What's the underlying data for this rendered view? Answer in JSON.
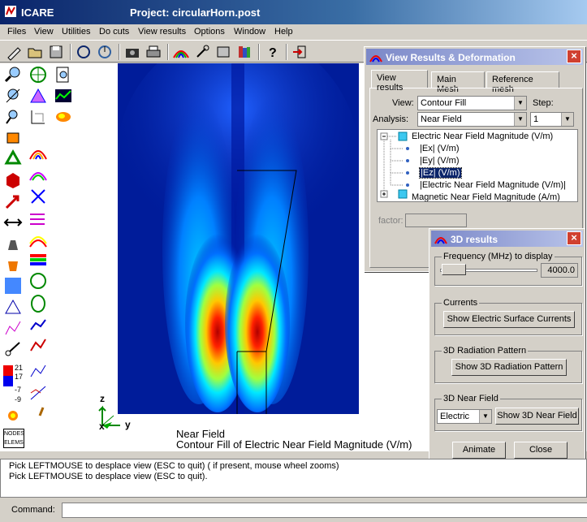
{
  "window": {
    "app_name": "ICARE",
    "title": "Project: circularHorn.post"
  },
  "menu": [
    "Files",
    "View",
    "Utilities",
    "Do cuts",
    "View results",
    "Options",
    "Window",
    "Help"
  ],
  "toolbar_icons": [
    "pencil-icon",
    "open-folder-icon",
    "save-disk-icon",
    "loop-icon",
    "loop-alt-icon",
    "camera-icon",
    "printer-icon",
    "rainbow-mesh-icon",
    "tool-icon",
    "tablet-icon",
    "books-icon",
    "help-icon",
    "exit-icon"
  ],
  "viewport": {
    "caption_line1": "Near Field",
    "caption_line2": "Contour Fill of Electric Near Field Magnitude (V/m)",
    "axes": {
      "z": "z",
      "x": "x",
      "y": "y"
    }
  },
  "legend_values": [
    "21",
    "17",
    "-7",
    "-9"
  ],
  "nodes_label": [
    "NODES",
    "ELEMS"
  ],
  "view_results_dialog": {
    "title": "View Results & Deformation",
    "tabs": [
      "View results",
      "Main Mesh",
      "Reference mesh"
    ],
    "view_label": "View:",
    "view_value": "Contour Fill",
    "step_label": "Step:",
    "analysis_label": "Analysis:",
    "analysis_value": "Near Field",
    "step_value": "1",
    "tree": {
      "electric": "Electric Near Field Magnitude (V/m)",
      "children": [
        "|Ex| (V/m)",
        "|Ey| (V/m)",
        "|Ez| (V/m)",
        "|Electric Near Field Magnitude (V/m)|"
      ],
      "magnetic": "Magnetic Near Field Magnitude (A/m)"
    },
    "factor_label": "factor:"
  },
  "results3d_dialog": {
    "title": "3D results",
    "frequency_label": "Frequency (MHz) to display",
    "frequency_value": "4000.0",
    "currents_group": "Currents",
    "currents_button": "Show Electric Surface Currents",
    "radiation_group": "3D Radiation Pattern",
    "radiation_button": "Show 3D Radiation Pattern",
    "nearfield_group": "3D Near Field",
    "nearfield_select": "Electric",
    "nearfield_button": "Show 3D Near Field",
    "animate_button": "Animate",
    "close_button": "Close"
  },
  "status": {
    "line1": "Pick LEFTMOUSE to desplace view (ESC to quit) ( if present, mouse wheel zooms)",
    "line2": "Pick LEFTMOUSE to desplace view (ESC to quit)."
  },
  "command": {
    "label": "Command:",
    "value": ""
  },
  "colors": {
    "field_low": "#001c9a",
    "field_high": "#e00000"
  }
}
